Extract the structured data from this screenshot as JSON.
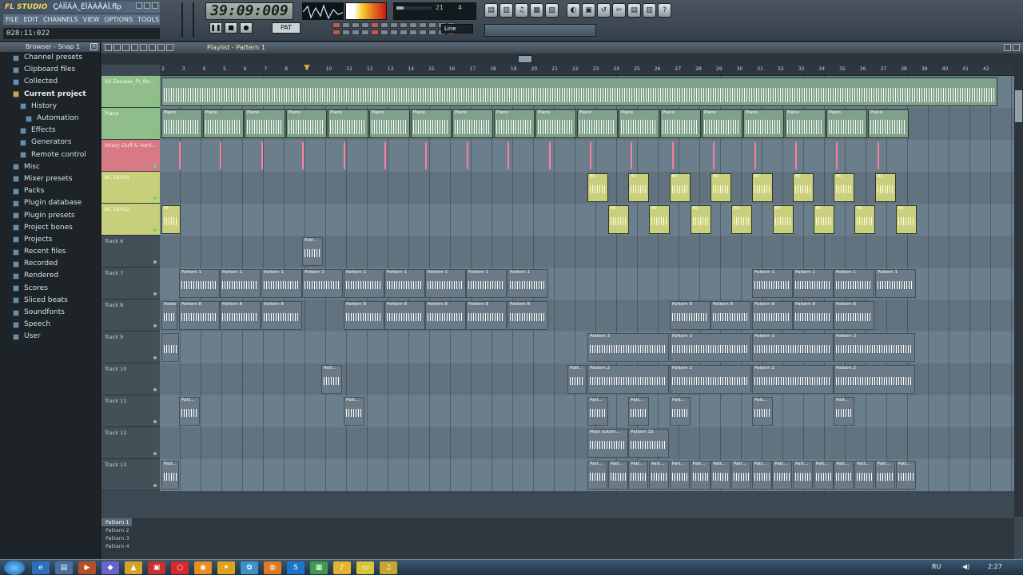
{
  "app": {
    "logo": "FL STUDIO",
    "file": "ÇÀÏÎÄÀ_ÈÎÂÀÄÀÎ.flp",
    "menu": [
      "FILE",
      "EDIT",
      "CHANNELS",
      "VIEW",
      "OPTIONS",
      "TOOLS",
      "HELP"
    ],
    "hint_time": "028:11:022"
  },
  "transport": {
    "time": "39:09:009",
    "snap": "Line",
    "pattern_mode": "PAT",
    "song_info": "",
    "cpu_percent": 21,
    "poly": "4"
  },
  "browser": {
    "title": "Browser - Snap 1",
    "items": [
      {
        "label": "Channel presets",
        "level": 0,
        "open": false
      },
      {
        "label": "Clipboard files",
        "level": 0,
        "open": false
      },
      {
        "label": "Collected",
        "level": 0,
        "open": false
      },
      {
        "label": "Current project",
        "level": 0,
        "open": true,
        "highlight": true
      },
      {
        "label": "History",
        "level": 1,
        "open": false
      },
      {
        "label": "Automation",
        "level": 2,
        "open": false
      },
      {
        "label": "Effects",
        "level": 1,
        "open": false
      },
      {
        "label": "Generators",
        "level": 1,
        "open": false
      },
      {
        "label": "Remote control",
        "level": 1,
        "open": false
      },
      {
        "label": "Misc",
        "level": 0,
        "open": false
      },
      {
        "label": "Mixer presets",
        "level": 0,
        "open": false
      },
      {
        "label": "Packs",
        "level": 0,
        "open": false
      },
      {
        "label": "Plugin database",
        "level": 0,
        "open": false
      },
      {
        "label": "Plugin presets",
        "level": 0,
        "open": false
      },
      {
        "label": "Project bones",
        "level": 0,
        "open": false
      },
      {
        "label": "Projects",
        "level": 0,
        "open": false
      },
      {
        "label": "Recent files",
        "level": 0,
        "open": false
      },
      {
        "label": "Recorded",
        "level": 0,
        "open": false
      },
      {
        "label": "Rendered",
        "level": 0,
        "open": false
      },
      {
        "label": "Scores",
        "level": 0,
        "open": false
      },
      {
        "label": "Sliced beats",
        "level": 0,
        "open": false
      },
      {
        "label": "Soundfonts",
        "level": 0,
        "open": false
      },
      {
        "label": "Speech",
        "level": 0,
        "open": false
      },
      {
        "label": "User",
        "level": 0,
        "open": false
      }
    ]
  },
  "playlist": {
    "title": "Playlist - Pattern 1",
    "ruler": [
      "2",
      "3",
      "4",
      "5",
      "6",
      "7",
      "8",
      "9",
      "10",
      "11",
      "12",
      "13",
      "14",
      "15",
      "16",
      "17",
      "18",
      "19",
      "20",
      "21",
      "22",
      "23",
      "24",
      "25",
      "26",
      "27",
      "28",
      "29",
      "30",
      "31",
      "32",
      "33",
      "34",
      "35",
      "36",
      "37",
      "38",
      "39",
      "40",
      "41",
      "42"
    ],
    "tracks": [
      {
        "name": "02 Zanada_Ft_Ro...",
        "color": "green"
      },
      {
        "name": "Piano",
        "color": "green"
      },
      {
        "name": "Hilary Duff & Verti...",
        "color": "pink"
      },
      {
        "name": "BC EEF01",
        "color": "yellow"
      },
      {
        "name": "BC EEF02",
        "color": "yellow"
      },
      {
        "name": "Track 6",
        "color": "plain"
      },
      {
        "name": "Track 7",
        "color": "plain"
      },
      {
        "name": "Track 8",
        "color": "plain"
      },
      {
        "name": "Track 9",
        "color": "plain"
      },
      {
        "name": "Track 10",
        "color": "plain"
      },
      {
        "name": "Track 11",
        "color": "plain"
      },
      {
        "name": "Track 12",
        "color": "plain"
      },
      {
        "name": "Track 13",
        "color": "plain"
      }
    ],
    "clip_labels": {
      "piano": "Piano",
      "bc": "BC",
      "p1": "Pattern 1",
      "p2": "Pattern 2",
      "p3": "Pattern 3",
      "p8": "Pattern 8",
      "p10": "Pattern 10",
      "patt": "Patt...",
      "main_auto": "Main autom..."
    },
    "patterns": [
      "Pattern 1",
      "Pattern 2",
      "Pattern 3",
      "Pattern 4"
    ]
  },
  "taskbar": {
    "lang": "RU",
    "clock": "2:27"
  }
}
